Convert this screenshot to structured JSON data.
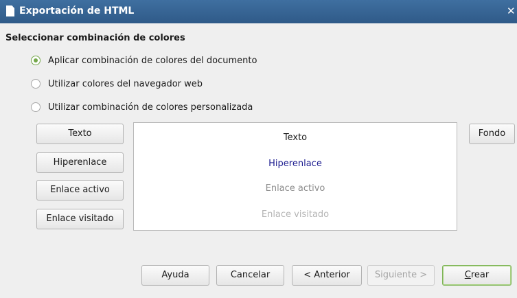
{
  "window": {
    "title": "Exportación de HTML",
    "close_glyph": "✕"
  },
  "section": {
    "heading": "Seleccionar combinación de colores"
  },
  "radios": [
    {
      "label": "Aplicar combinación de colores del documento",
      "checked": true
    },
    {
      "label": "Utilizar colores del navegador web",
      "checked": false
    },
    {
      "label": "Utilizar combinación de colores personalizada",
      "checked": false
    }
  ],
  "color_buttons": {
    "text": "Texto",
    "hyperlink": "Hiperenlace",
    "active_link": "Enlace activo",
    "visited_link": "Enlace visitado",
    "background": "Fondo"
  },
  "preview": {
    "text": {
      "label": "Texto",
      "color": "#1a1a1a"
    },
    "hyperlink": {
      "label": "Hiperenlace",
      "color": "#1c1c8f"
    },
    "active_link": {
      "label": "Enlace activo",
      "color": "#8c8c8c"
    },
    "visited_link": {
      "label": "Enlace visitado",
      "color": "#b4b4b4"
    }
  },
  "footer": {
    "help": "Ayuda",
    "cancel": "Cancelar",
    "back": "< Anterior",
    "next": "Siguiente >",
    "finish_mnemonic": "C",
    "finish_rest": "rear"
  },
  "colors": {
    "accent": "#74a74a",
    "titlebar": "#3a6797"
  }
}
